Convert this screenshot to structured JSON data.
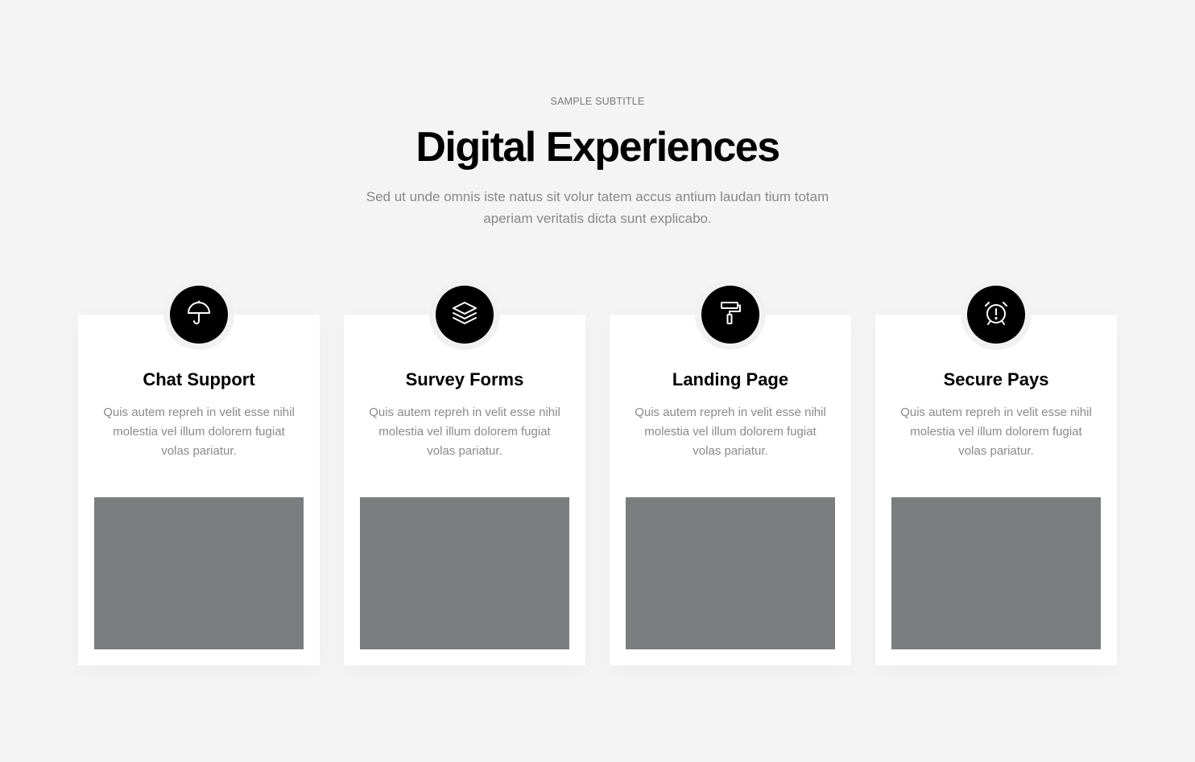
{
  "header": {
    "subtitle": "SAMPLE SUBTITLE",
    "title": "Digital Experiences",
    "intro": "Sed ut unde omnis iste natus sit volur tatem accus antium laudan tium totam aperiam veritatis dicta sunt explicabo."
  },
  "cards": [
    {
      "icon": "umbrella-icon",
      "title": "Chat Support",
      "text": "Quis autem repreh in velit esse nihil molestia vel illum dolorem fugiat volas pariatur."
    },
    {
      "icon": "layers-icon",
      "title": "Survey Forms",
      "text": "Quis autem repreh in velit esse nihil molestia vel illum dolorem fugiat volas pariatur."
    },
    {
      "icon": "paint-roller-icon",
      "title": "Landing Page",
      "text": "Quis autem repreh in velit esse nihil molestia vel illum dolorem fugiat volas pariatur."
    },
    {
      "icon": "alarm-clock-icon",
      "title": "Secure Pays",
      "text": "Quis autem repreh in velit esse nihil molestia vel illum dolorem fugiat volas pariatur."
    }
  ],
  "colors": {
    "background": "#f4f4f4",
    "card": "#ffffff",
    "icon_circle": "#000000",
    "image_placeholder": "#7c7d7e",
    "muted_text": "#888888"
  }
}
